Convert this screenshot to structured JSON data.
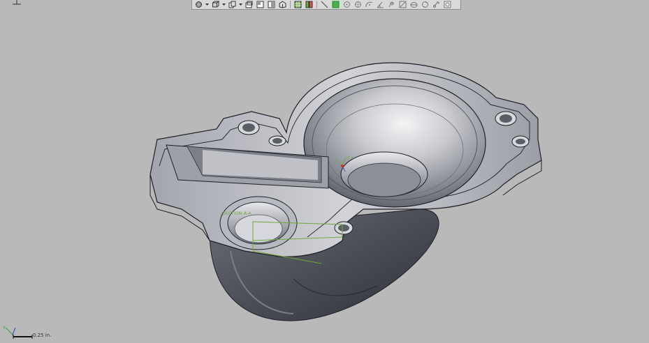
{
  "viewport": {
    "background": "#b9b9b9",
    "part_colors": {
      "face_light": "#e8e8ea",
      "face_mid": "#8a8d98",
      "face_dark": "#3f434c",
      "edge": "#1e1f24"
    },
    "section_label": "SECTION A-A",
    "coord_label": "Z X",
    "accent_green": "#6fa83b"
  },
  "toolbar": {
    "buttons": [
      {
        "icon": "view-orientation-icon"
      },
      {
        "icon": "dropdown-arrow-icon"
      },
      {
        "icon": "display-style-icon"
      },
      {
        "icon": "dropdown-arrow-icon"
      },
      {
        "icon": "standard-views-icon"
      },
      {
        "icon": "dropdown-arrow-icon"
      },
      {
        "icon": "front-view-icon"
      },
      {
        "icon": "top-view-icon"
      },
      {
        "icon": "right-view-icon"
      },
      {
        "icon": "isometric-view-icon"
      },
      {
        "icon": "section-view-icon"
      },
      {
        "icon": "section-split-icon"
      },
      {
        "icon": "sketch-line-icon"
      },
      {
        "icon": "plane-select-icon",
        "active": true
      },
      {
        "icon": "point-snap-icon"
      },
      {
        "icon": "circle-snap-icon"
      },
      {
        "icon": "arc-snap-icon"
      },
      {
        "icon": "angle-measure-icon"
      },
      {
        "icon": "edge-measure-icon"
      },
      {
        "icon": "distance-measure-icon"
      },
      {
        "icon": "mass-properties-icon"
      },
      {
        "icon": "rotate-view-icon"
      },
      {
        "icon": "link-icon"
      },
      {
        "icon": "settings-icon"
      }
    ]
  },
  "scale": {
    "label": "0.25 in."
  },
  "triad": {
    "y_label": "Y",
    "x_label": "X"
  }
}
